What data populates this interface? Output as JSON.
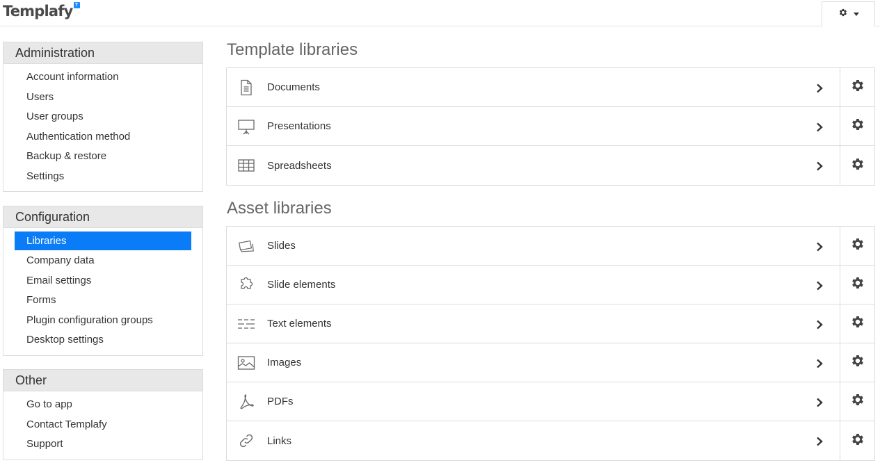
{
  "app": {
    "logo_text": "Templafy",
    "logo_badge": "T"
  },
  "sidebar": {
    "administration": {
      "title": "Administration",
      "items": [
        "Account information",
        "Users",
        "User groups",
        "Authentication method",
        "Backup & restore",
        "Settings"
      ]
    },
    "configuration": {
      "title": "Configuration",
      "items": [
        "Libraries",
        "Company data",
        "Email settings",
        "Forms",
        "Plugin configuration groups",
        "Desktop settings"
      ],
      "active": "Libraries"
    },
    "other": {
      "title": "Other",
      "items": [
        "Go to app",
        "Contact Templafy",
        "Support"
      ]
    }
  },
  "main": {
    "template_libraries": {
      "title": "Template libraries",
      "items": [
        {
          "label": "Documents",
          "icon": "document-icon"
        },
        {
          "label": "Presentations",
          "icon": "presentation-icon"
        },
        {
          "label": "Spreadsheets",
          "icon": "spreadsheet-icon"
        }
      ]
    },
    "asset_libraries": {
      "title": "Asset libraries",
      "items": [
        {
          "label": "Slides",
          "icon": "slides-icon"
        },
        {
          "label": "Slide elements",
          "icon": "puzzle-icon"
        },
        {
          "label": "Text elements",
          "icon": "text-lines-icon"
        },
        {
          "label": "Images",
          "icon": "image-icon"
        },
        {
          "label": "PDFs",
          "icon": "pdf-icon"
        },
        {
          "label": "Links",
          "icon": "link-icon"
        }
      ]
    }
  },
  "colors": {
    "accent": "#0a7cf7",
    "panel_header": "#e8e8e8",
    "border": "#dcdcdc",
    "icon": "#555555"
  }
}
